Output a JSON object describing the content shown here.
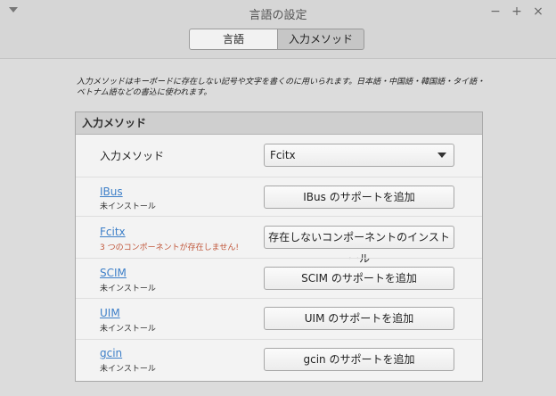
{
  "window": {
    "title": "言語の設定",
    "controls": {
      "minimize": "−",
      "maximize": "+",
      "close": "×"
    }
  },
  "tabs": [
    {
      "label": "言語",
      "selected": false
    },
    {
      "label": "入力メソッド",
      "selected": true
    }
  ],
  "description": "入力メソッドはキーボードに存在しない記号や文字を書くのに用いられます。日本語・中国語・韓国語・タイ語・ベトナム語などの書込に使われます。",
  "panel": {
    "header": "入力メソッド",
    "method_row": {
      "label": "入力メソッド",
      "selected": "Fcitx"
    },
    "rows": [
      {
        "name": "IBus",
        "status": "未インストール",
        "status_error": false,
        "button": "IBus のサポートを追加"
      },
      {
        "name": "Fcitx",
        "status": "3 つのコンポーネントが存在しません!",
        "status_error": true,
        "button": "存在しないコンポーネントのインストール"
      },
      {
        "name": "SCIM",
        "status": "未インストール",
        "status_error": false,
        "button": "SCIM のサポートを追加"
      },
      {
        "name": "UIM",
        "status": "未インストール",
        "status_error": false,
        "button": "UIM のサポートを追加"
      },
      {
        "name": "gcin",
        "status": "未インストール",
        "status_error": false,
        "button": "gcin のサポートを追加"
      }
    ]
  }
}
